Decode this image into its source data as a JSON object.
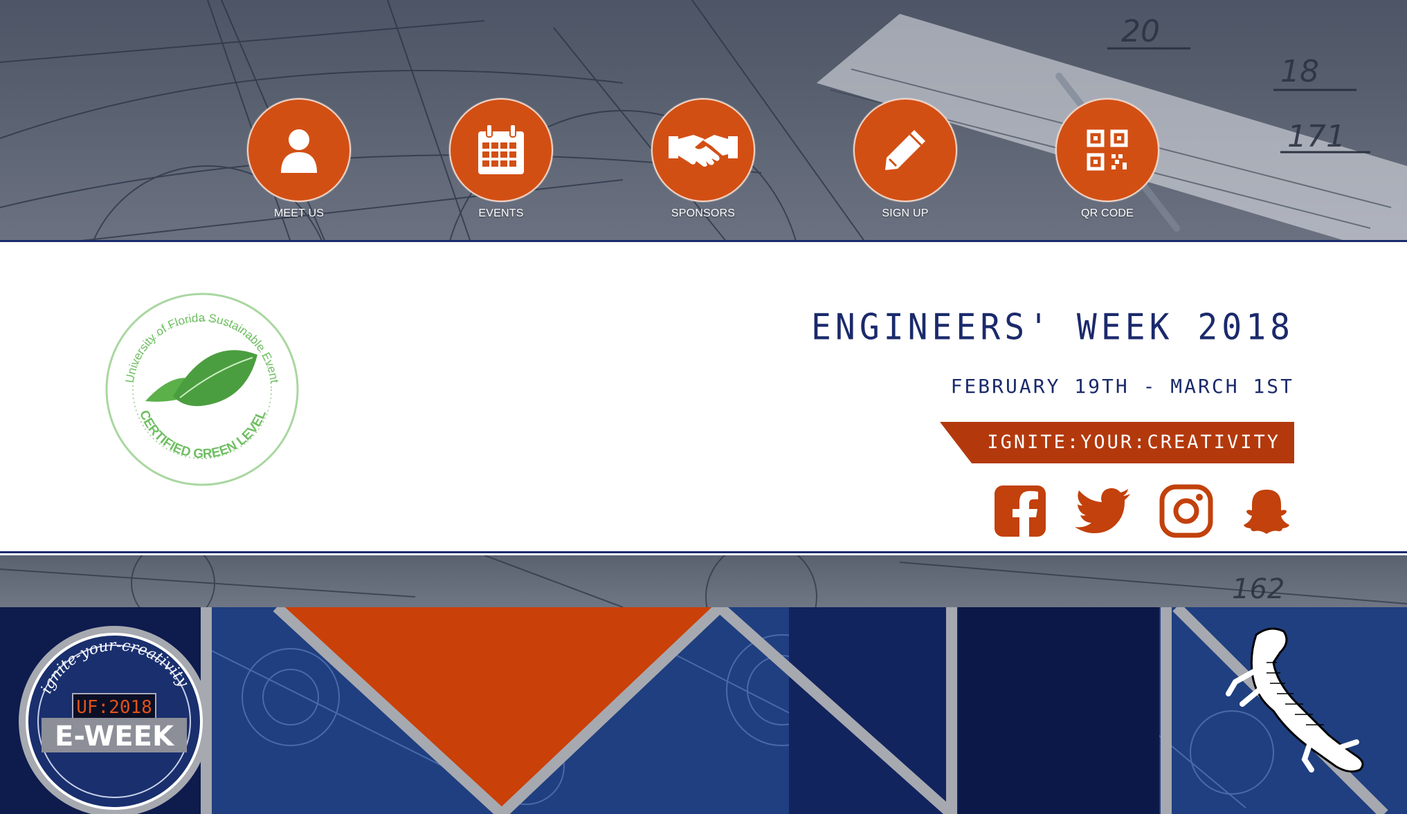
{
  "nav": {
    "items": [
      {
        "label": "MEET US",
        "icon": "user-icon"
      },
      {
        "label": "EVENTS",
        "icon": "calendar-icon"
      },
      {
        "label": "SPONSORS",
        "icon": "handshake-icon"
      },
      {
        "label": "SIGN UP",
        "icon": "pencil-icon"
      },
      {
        "label": "QR CODE",
        "icon": "qr-code-icon"
      }
    ]
  },
  "seal": {
    "top_text": "University of Florida Sustainable Event",
    "bottom_text": "CERTIFIED GREEN LEVEL"
  },
  "event": {
    "title": "ENGINEERS' WEEK 2018",
    "dates": "FEBRUARY 19TH - MARCH 1ST",
    "slogan": "IGNITE:YOUR:CREATIVITY"
  },
  "social": [
    {
      "name": "facebook-icon"
    },
    {
      "name": "twitter-icon"
    },
    {
      "name": "instagram-icon"
    },
    {
      "name": "snapchat-icon"
    }
  ],
  "badge": {
    "arc_text": "ignite-your-creativity",
    "display": "UF:2018",
    "title": "E-WEEK"
  },
  "colors": {
    "accent": "#d24f14",
    "navy": "#1b2a6b",
    "banner_blue": "#1d3a78",
    "green": "#5bb04a"
  }
}
